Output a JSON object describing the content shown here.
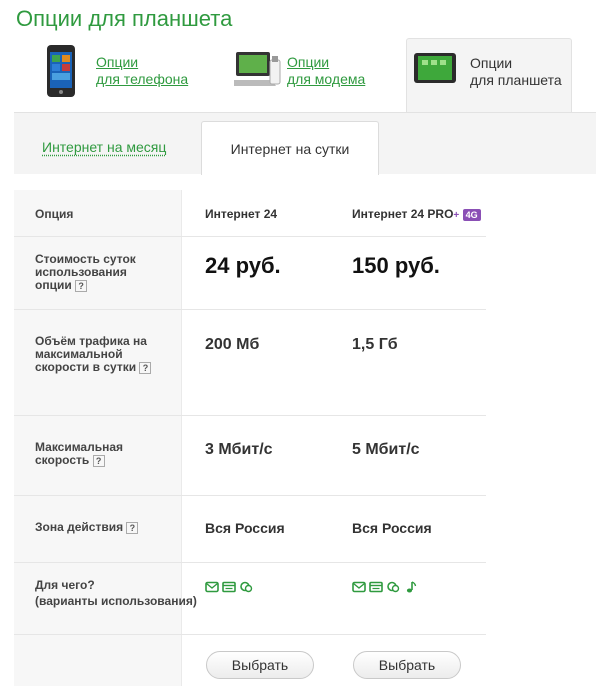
{
  "page": {
    "title": "Опции для планшета"
  },
  "device_tabs": [
    {
      "line1": "Опции",
      "line2": "для телефона",
      "icon": "smartphone-icon"
    },
    {
      "line1": "Опции",
      "line2": "для модема",
      "icon": "usb-modem-icon"
    },
    {
      "line1": "Опции",
      "line2": "для планшета",
      "icon": "tablet-icon"
    }
  ],
  "period_tabs": [
    {
      "label": "Интернет на месяц"
    },
    {
      "label": "Интернет на сутки"
    }
  ],
  "table": {
    "header": {
      "label": "Опция",
      "plan1": "Интернет 24",
      "plan2": "Интернет 24 PRO",
      "plan2_plus": "+",
      "plan2_badge": "4G"
    },
    "rows": {
      "price": {
        "label": "Стоимость суток использования опции",
        "help": "?",
        "plan1": "24 руб.",
        "plan2": "150 руб."
      },
      "traffic": {
        "label": "Объём трафика на максимальной скорости в сутки",
        "help": "?",
        "plan1": "200 Мб",
        "plan2": "1,5 Гб"
      },
      "speed": {
        "label": "Максимальная скорость",
        "help": "?",
        "plan1": "3 Мбит/с",
        "plan2": "5 Мбит/с"
      },
      "zone": {
        "label": "Зона действия",
        "help": "?",
        "plan1": "Вся Россия",
        "plan2": "Вся Россия"
      },
      "usage": {
        "label": "Для чего?",
        "sublabel": "(варианты использования)",
        "plan1_icons": [
          "mail-icon",
          "browser-icon",
          "chat-icon"
        ],
        "plan2_icons": [
          "mail-icon",
          "browser-icon",
          "chat-icon",
          "music-icon"
        ]
      }
    },
    "select_label": "Выбрать"
  },
  "colors": {
    "accent": "#2f9a3f",
    "badge_4g": "#8a4fb5"
  }
}
